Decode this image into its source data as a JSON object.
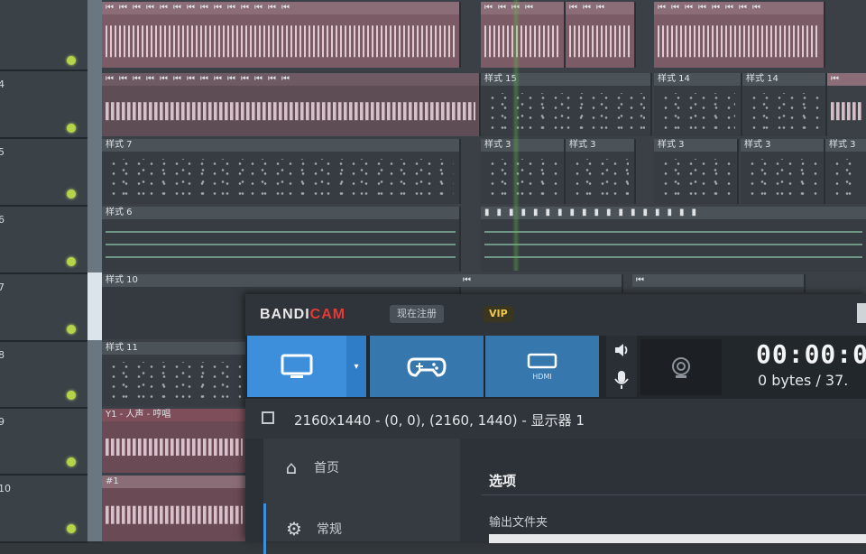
{
  "tracks": [
    {
      "label": ""
    },
    {
      "label": "4"
    },
    {
      "label": "5"
    },
    {
      "label": "6"
    },
    {
      "label": "7"
    },
    {
      "label": "8"
    },
    {
      "label": "9"
    },
    {
      "label": "10"
    }
  ],
  "playlist": {
    "clips": {
      "pattern15": "样式 15",
      "pattern14a": "样式 14",
      "pattern14b": "样式 14",
      "pattern7": "样式 7",
      "pattern3a": "样式 3",
      "pattern3b": "样式 3",
      "pattern3c": "样式 3",
      "pattern3d": "样式 3",
      "pattern3e": "样式 3",
      "pattern6": "样式 6",
      "pattern10": "样式 10",
      "pattern11": "样式 11",
      "audio9": "Y1 - 人声 - 哼唱",
      "audio10": "#1"
    }
  },
  "bandicam": {
    "logo_main": "BANDI",
    "logo_accent": "CAM",
    "register_label": "现在注册",
    "vip_label": "VIP",
    "mode_rect_icon": "monitor-icon",
    "mode_game_icon": "gamepad-icon",
    "mode_device_label": "HDMI",
    "timer": "00:00:0",
    "bytes": "0 bytes / 37.",
    "resolution_text": "2160x1440 - (0, 0), (2160, 1440) - 显示器 1",
    "sidebar": [
      {
        "label": "首页",
        "icon": "home-icon"
      },
      {
        "label": "常规",
        "icon": "gear-icon"
      }
    ],
    "section_title": "选项",
    "output_folder_label": "输出文件夹"
  },
  "colors": {
    "accent_blue": "#3d8fdc",
    "logo_red": "#e53935",
    "led_green": "#b6d44a",
    "audio_clip": "#8a6d77"
  }
}
